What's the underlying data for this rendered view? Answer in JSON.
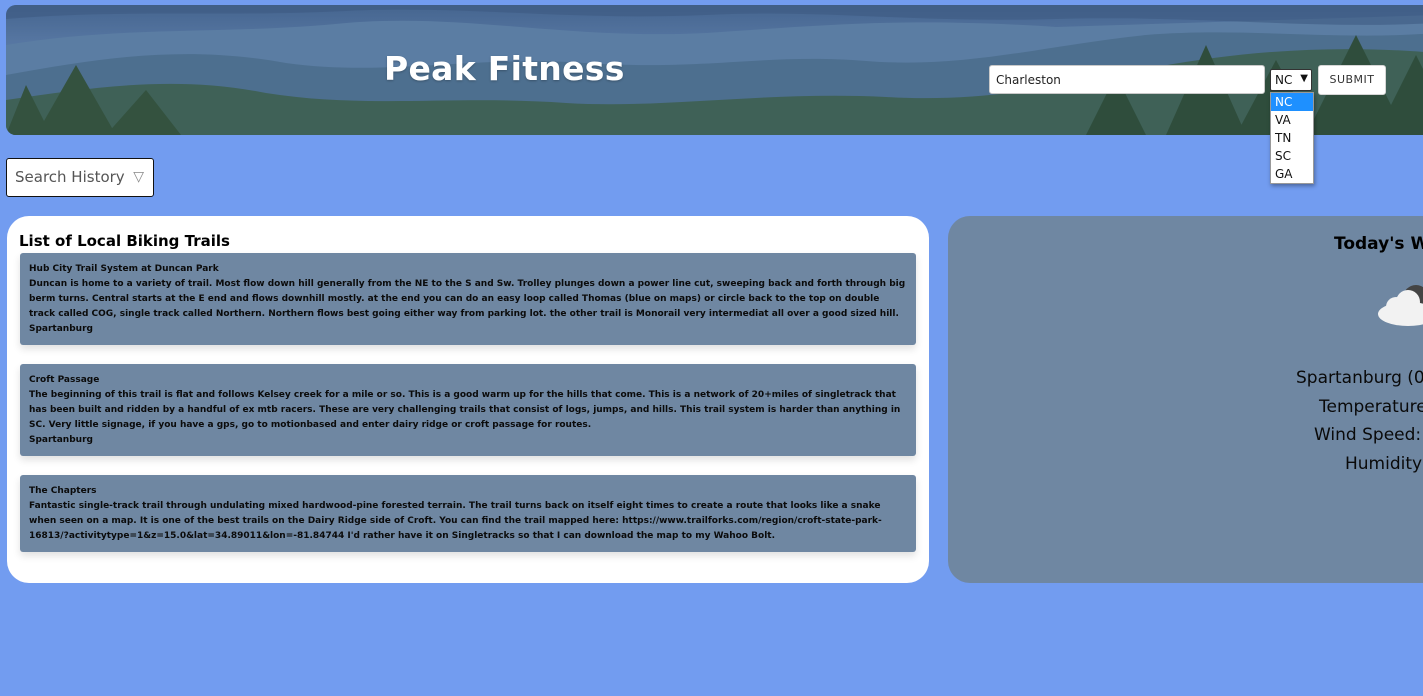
{
  "header": {
    "brand": "Peak Fitness",
    "city_input": {
      "value": "Charleston",
      "placeholder": ""
    },
    "state_select": {
      "selected": "NC",
      "options": [
        "NC",
        "VA",
        "TN",
        "SC",
        "GA"
      ]
    },
    "submit_label": "SUBMIT"
  },
  "search_history": {
    "label": "Search History",
    "icon": "triangle-down-icon"
  },
  "trails": {
    "title": "List of Local Biking Trails",
    "items": [
      {
        "name": "Hub City Trail System at Duncan Park",
        "description": "Duncan is home to a variety of trail. Most flow down hill generally from the NE to the S and Sw. Trolley plunges down a power line cut, sweeping back and forth through big berm turns. Central starts at the E end and flows downhill mostly. at the end you can do an easy loop called Thomas (blue on maps) or circle back to the top on double track called COG, single track called Northern. Northern flows best going either way from parking lot. the other trail is Monorail very intermediat all over a good sized hill.",
        "city": "Spartanburg"
      },
      {
        "name": "Croft Passage",
        "description": "The beginning of this trail is flat and follows Kelsey creek for a mile or so. This is a good warm up for the hills that come. This is a network of 20+miles of singletrack that has been built and ridden by a handful of ex mtb racers. These are very challenging trails that consist of logs, jumps, and hills. This trail system is harder than anything in SC. Very little signage, if you have a gps, go to motionbased and enter dairy ridge or croft passage for routes.",
        "city": "Spartanburg"
      },
      {
        "name": "The Chapters",
        "description": "Fantastic single-track trail through undulating mixed hardwood-pine forested terrain.  The trail turns back on itself eight times to create a route that looks like a snake when seen on a map.  It is one of the best trails on the Dairy Ridge side of Croft.  You can find the trail mapped here: https://www.trailforks.com/region/croft-state-park-16813/?activitytype=1&z=15.0&lat=34.89011&lon=-81.84744 I'd rather have it on Singletracks so that I can download the map to my Wahoo Bolt.",
        "city": ""
      }
    ]
  },
  "weather": {
    "title": "Today's W",
    "icon": "cloud-icon",
    "location": "Spartanburg (0",
    "temperature_label": "Temperature",
    "wind_label": "Wind Speed:",
    "humidity_label": "Humidity"
  },
  "colors": {
    "page_bg": "#729cf0",
    "card_bg": "#6f87a2",
    "panel_bg": "#ffffff",
    "dropdown_highlight": "#1e90ff"
  }
}
